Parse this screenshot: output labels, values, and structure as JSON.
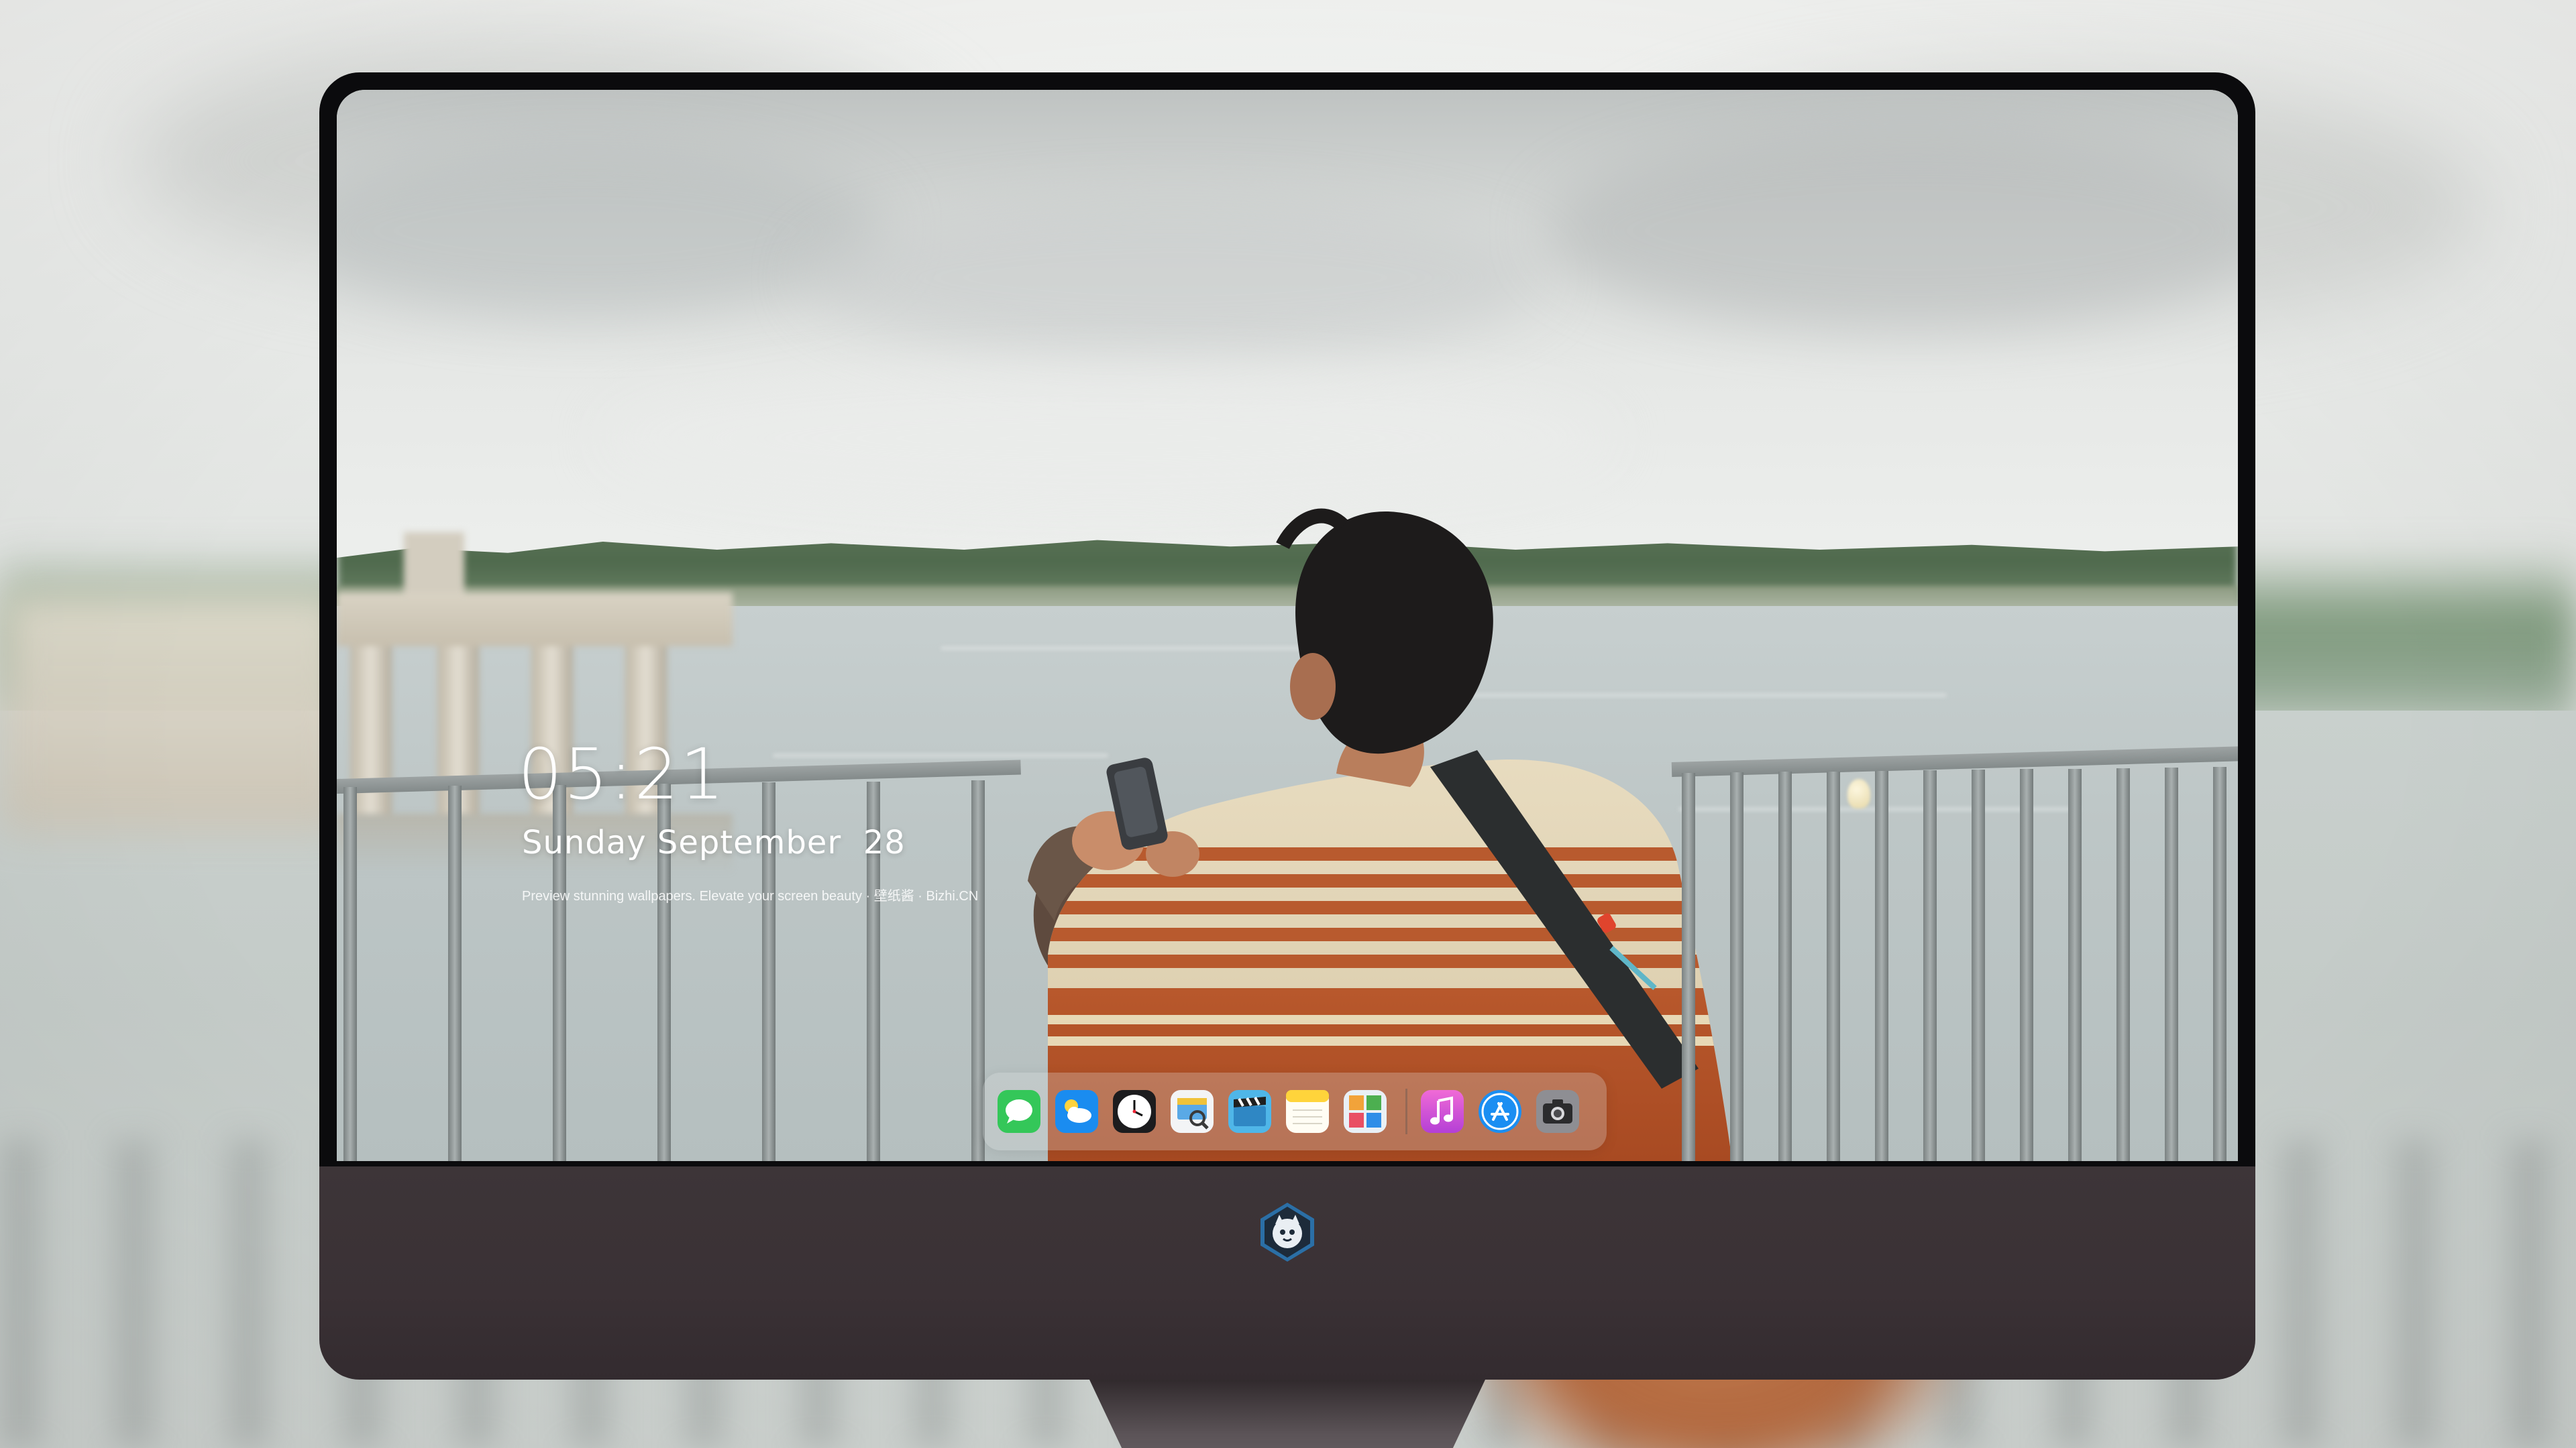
{
  "lockscreen": {
    "time": "05:21",
    "date": "Sunday September  28",
    "tagline": "Preview stunning wallpapers. Elevate your screen beauty · 壁纸酱 · Bizhi.CN"
  },
  "dock": {
    "apps": [
      {
        "name": "Messages",
        "icon": "messages-icon",
        "color": "#34c759"
      },
      {
        "name": "Weather",
        "icon": "weather-icon",
        "color": "#1a8cf0"
      },
      {
        "name": "Clock",
        "icon": "clock-icon",
        "color": "#ffffff"
      },
      {
        "name": "Preview",
        "icon": "preview-icon",
        "color": "#f0c23a"
      },
      {
        "name": "Clips",
        "icon": "clapper-icon",
        "color": "#4fb6e8"
      },
      {
        "name": "Notes",
        "icon": "notes-icon",
        "color": "#ffd43b"
      },
      {
        "name": "Photo Booth",
        "icon": "photo-grid-icon",
        "color": "#e9f0f6"
      },
      {
        "name": "iTunes",
        "icon": "music-note-icon",
        "color": "#d745d9"
      },
      {
        "name": "App Store",
        "icon": "app-store-icon",
        "color": "#1b8ef2"
      },
      {
        "name": "Camera",
        "icon": "camera-icon",
        "color": "#8e8e93"
      }
    ]
  },
  "monitor": {
    "logo": "mascot-badge-icon",
    "bezel_color": "#0b0b0d",
    "chin_color": "#3d3538"
  }
}
